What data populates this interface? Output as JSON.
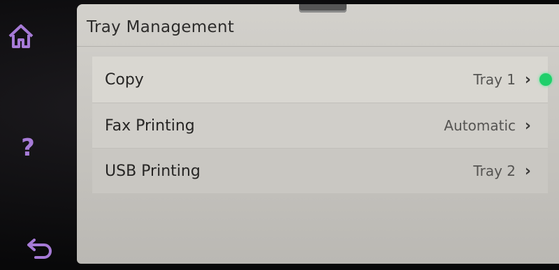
{
  "screen": {
    "title": "Tray Management"
  },
  "items": [
    {
      "label": "Copy",
      "value": "Tray 1",
      "active": true
    },
    {
      "label": "Fax Printing",
      "value": "Automatic",
      "active": false
    },
    {
      "label": "USB Printing",
      "value": "Tray 2",
      "active": false
    }
  ],
  "bezel": {
    "home_icon": "home-icon",
    "help_glyph": "?",
    "back_icon": "back-arrow-icon"
  },
  "colors": {
    "accent_purple": "#a67ad6",
    "status_green": "#1fcf6a"
  }
}
